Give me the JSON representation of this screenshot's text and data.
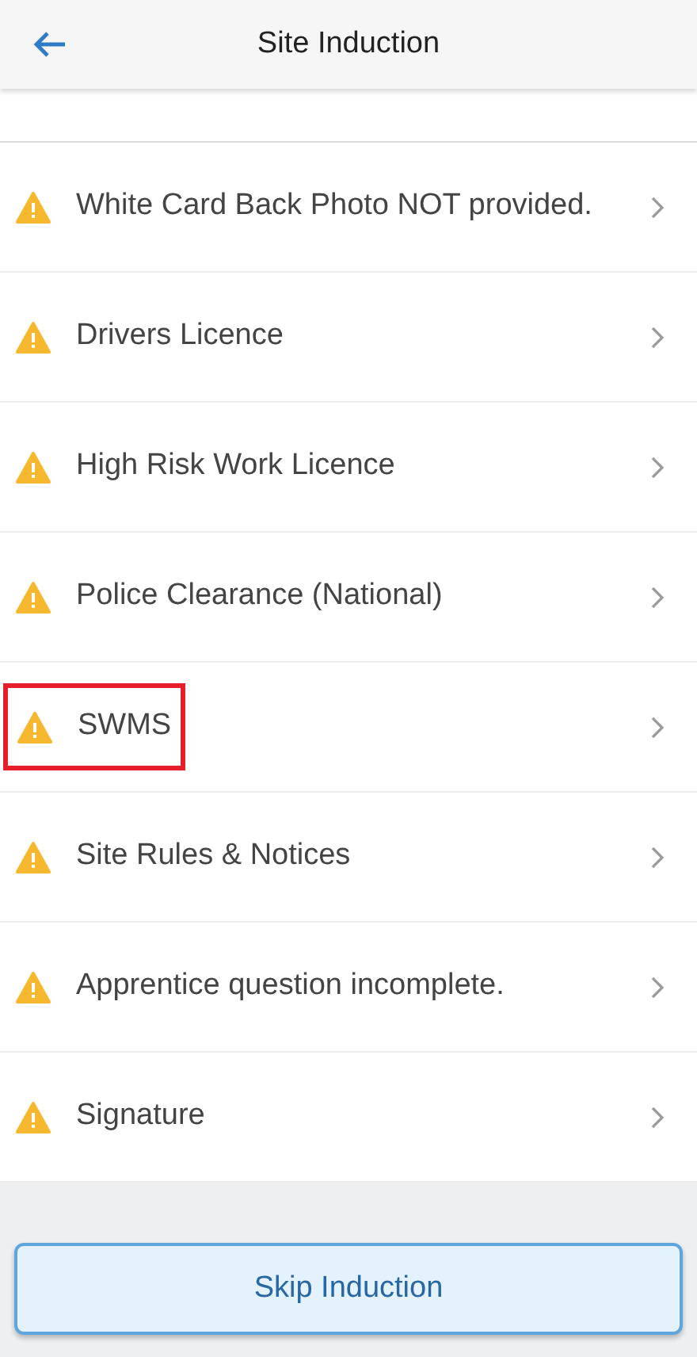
{
  "header": {
    "title": "Site Induction"
  },
  "items": [
    {
      "label": "White Card Back Photo NOT provided.",
      "highlighted": false
    },
    {
      "label": "Drivers Licence",
      "highlighted": false
    },
    {
      "label": "High Risk Work Licence",
      "highlighted": false
    },
    {
      "label": "Police Clearance (National)",
      "highlighted": false
    },
    {
      "label": "SWMS",
      "highlighted": true
    },
    {
      "label": "Site Rules & Notices",
      "highlighted": false
    },
    {
      "label": "Apprentice question incomplete.",
      "highlighted": false
    },
    {
      "label": "Signature",
      "highlighted": false
    }
  ],
  "footer": {
    "button": "Skip Induction"
  }
}
